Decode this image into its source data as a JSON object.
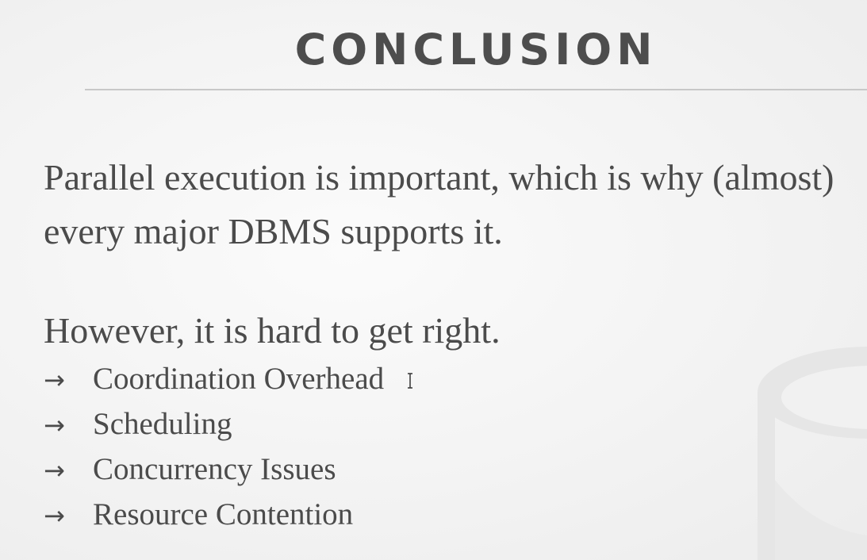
{
  "slide": {
    "title": "CONCLUSION",
    "paragraph_1": "Parallel execution is important, which is why (almost) every major DBMS supports it.",
    "paragraph_2": "However, it is hard to get right.",
    "bullet_arrow": "→",
    "bullets": [
      "Coordination Overhead",
      "Scheduling",
      "Concurrency Issues",
      "Resource Contention"
    ]
  },
  "colors": {
    "background": "#f3f3f3",
    "text": "#4b4b4b",
    "rule": "#c8c8c8",
    "watermark": "#e4e4e4"
  },
  "icons": {
    "watermark": "database-cylinder-icon",
    "cursor": "text-cursor-icon"
  }
}
